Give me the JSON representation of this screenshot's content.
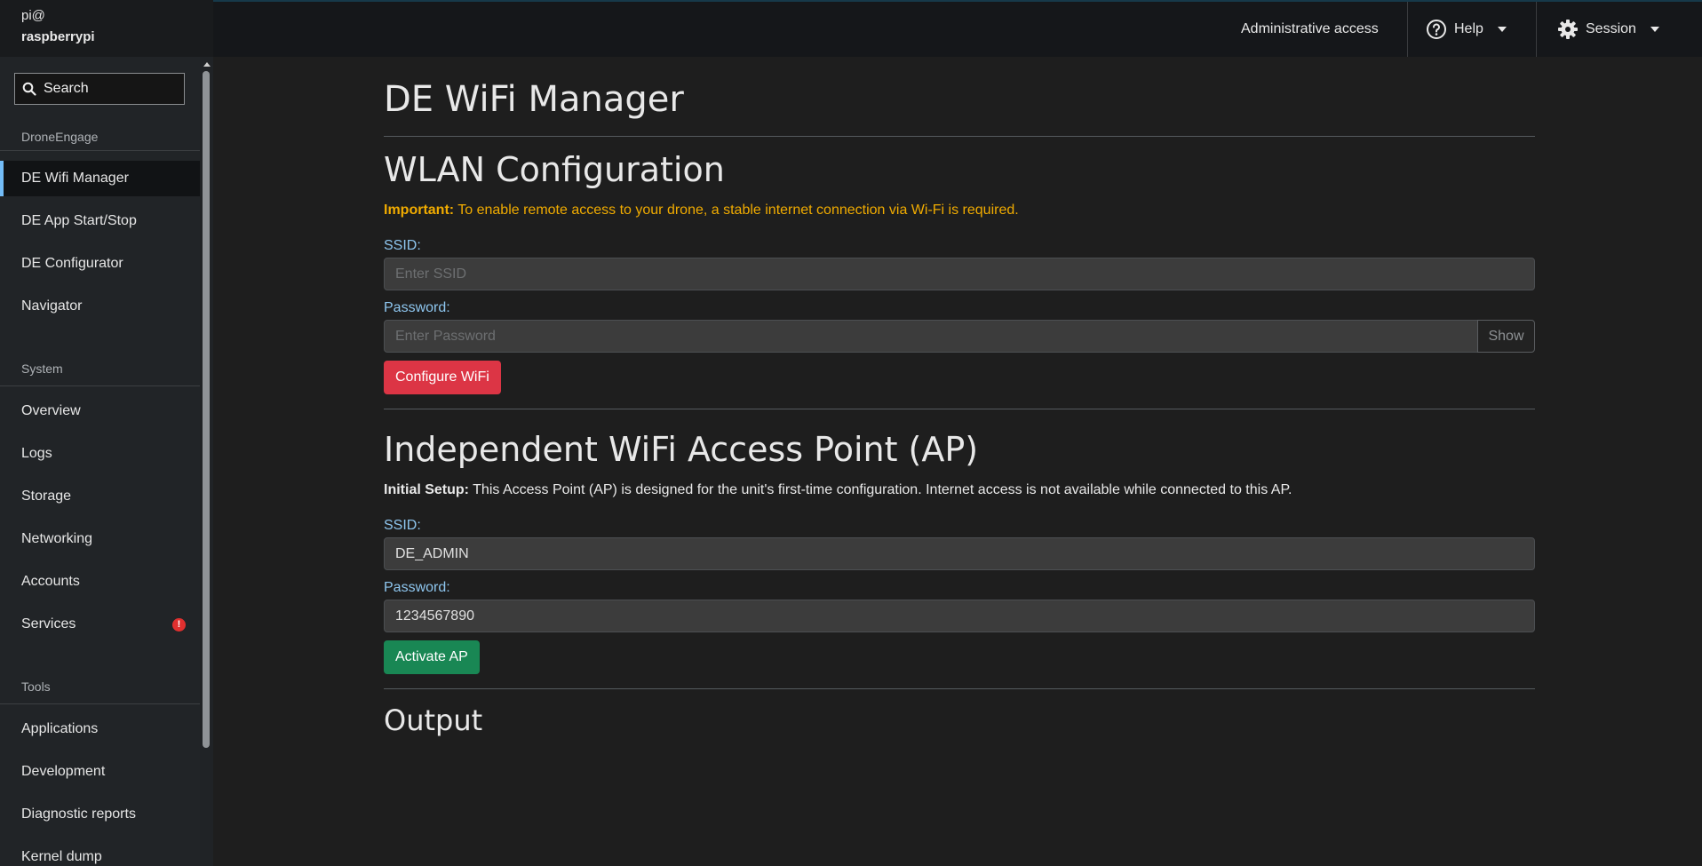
{
  "sidebar": {
    "host_user": "pi@",
    "host_name": "raspberrypi",
    "search_label": "Search",
    "sections": {
      "droneengage": "DroneEngage",
      "system": "System",
      "tools": "Tools"
    },
    "droneengage_items": [
      "DE Wifi Manager",
      "DE App Start/Stop",
      "DE Configurator",
      "Navigator"
    ],
    "system_items": [
      "Overview",
      "Logs",
      "Storage",
      "Networking",
      "Accounts",
      "Services"
    ],
    "tools_items": [
      "Applications",
      "Development",
      "Diagnostic reports",
      "Kernel dump"
    ],
    "services_badge": "!"
  },
  "topbar": {
    "admin_access": "Administrative access",
    "help": "Help",
    "session": "Session"
  },
  "page": {
    "title": "DE WiFi Manager",
    "wlan": {
      "title": "WLAN Configuration",
      "important_label": "Important:",
      "important_text": " To enable remote access to your drone, a stable internet connection via Wi-Fi is required.",
      "ssid_label": "SSID:",
      "ssid_placeholder": "Enter SSID",
      "ssid_value": "",
      "password_label": "Password:",
      "password_placeholder": "Enter Password",
      "password_value": "",
      "show_button": "Show",
      "configure_button": "Configure WiFi"
    },
    "ap": {
      "title": "Independent WiFi Access Point (AP)",
      "setup_label": "Initial Setup:",
      "setup_text": " This Access Point (AP) is designed for the unit's first-time configuration. Internet access is not available while connected to this AP.",
      "ssid_label": "SSID:",
      "ssid_value": "DE_ADMIN",
      "password_label": "Password:",
      "password_value": "1234567890",
      "activate_button": "Activate AP"
    },
    "output_title": "Output"
  },
  "colors": {
    "accent_active": "#73bcf7",
    "warning": "#f0ab00",
    "danger_button": "#dc3545",
    "success_button": "#198754",
    "label_blue": "#8ec6ef"
  }
}
